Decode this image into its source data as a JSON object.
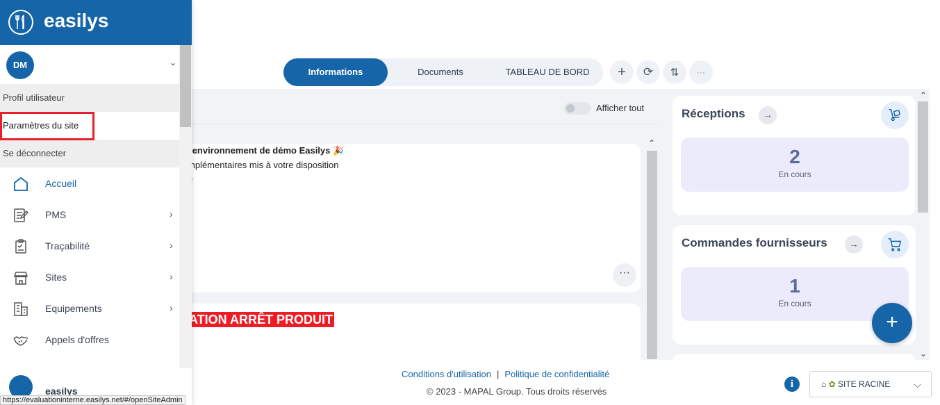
{
  "brand": {
    "name": "easilys"
  },
  "user": {
    "initials": "DM"
  },
  "user_menu": [
    "Profil utilisateur",
    "Paramètres du site",
    "Se déconnecter"
  ],
  "nav": [
    {
      "label": "Accueil",
      "icon": "home-icon",
      "has_submenu": false
    },
    {
      "label": "PMS",
      "icon": "edit-document-icon",
      "has_submenu": true
    },
    {
      "label": "Traçabilité",
      "icon": "clipboard-icon",
      "has_submenu": true
    },
    {
      "label": "Sites",
      "icon": "store-icon",
      "has_submenu": true
    },
    {
      "label": "Equipements",
      "icon": "building-icon",
      "has_submenu": true
    },
    {
      "label": "Appels d'offres",
      "icon": "handshake-icon",
      "has_submenu": false
    }
  ],
  "sidebar_bottom": {
    "name": "easilys"
  },
  "tabs": [
    "Informations",
    "Documents",
    "TABLEAU DE BORD"
  ],
  "active_tab": "Informations",
  "toolbar": {
    "add": "+",
    "refresh": "⟳",
    "sort": "⇅",
    "more": "···"
  },
  "toggle": {
    "label": "Afficher tout",
    "checked": false
  },
  "news": [
    {
      "title": "l'environnement de démo Easilys",
      "lines": [
        "mplémentaires mis à votre disposition",
        "e"
      ],
      "more": "···"
    },
    {
      "title": "ATION ARRÊT PRODUIT"
    }
  ],
  "widgets": [
    {
      "title": "Réceptions",
      "count": "2",
      "status": "En cours",
      "icon": "dolly-icon"
    },
    {
      "title": "Commandes fournisseurs",
      "count": "1",
      "status": "En cours",
      "icon": "cart-icon"
    }
  ],
  "fab": "+",
  "footer": {
    "terms": "Conditions d'utilisation",
    "separator": "|",
    "privacy": "Politique de confidentialité",
    "copyright": "© 2023 - MAPAL Group. Tous droits réservés"
  },
  "info_button": "i",
  "site_select": {
    "value": "SITE RACINE"
  },
  "status_url": "https://evaluationinterne.easilys.net/#/openSiteAdmin",
  "colors": {
    "primary": "#1565a8",
    "highlight": "#e8202a",
    "alert": "#ee1c25",
    "widget_box": "#ecebfc"
  }
}
